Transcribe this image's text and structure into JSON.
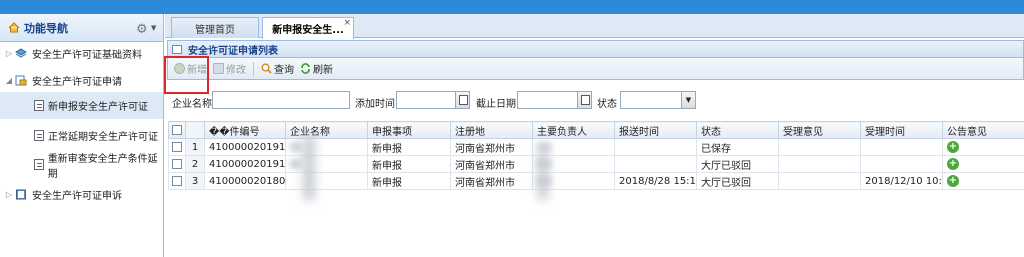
{
  "sidebar": {
    "title": "功能导航",
    "nodes": [
      {
        "label": "安全生产许可证基础资料",
        "expanded": false
      },
      {
        "label": "安全生产许可证申请",
        "expanded": true
      },
      {
        "label": "安全生产许可证申诉",
        "expanded": false
      }
    ],
    "sub_items": [
      {
        "label": "新申报安全生产许可证",
        "selected": true
      },
      {
        "label": "正常延期安全生产许可证",
        "selected": false
      },
      {
        "label": "重新审查安全生产条件延期",
        "selected": false
      }
    ]
  },
  "tabs": [
    {
      "label": "管理首页",
      "active": false
    },
    {
      "label": "新申报安全生...",
      "active": true,
      "close": "×"
    }
  ],
  "panel": {
    "title": "安全许可证申请列表"
  },
  "toolbar": {
    "add": "新增",
    "edit": "修改",
    "query": "查询",
    "refresh": "刷新"
  },
  "search": {
    "company_label": "企业名称",
    "company_value": "",
    "add_time_label": "添加时间",
    "add_time_value": "",
    "deadline_label": "截止日期",
    "deadline_value": "",
    "status_label": "状态",
    "status_value": ""
  },
  "grid": {
    "headers": [
      "��件编号",
      "企业名称",
      "申报事项",
      "注册地",
      "主要负责人",
      "报送时间",
      "状态",
      "受理意见",
      "受理时间",
      "公告意见"
    ],
    "rows": [
      {
        "num": "1",
        "code": "410000020191...",
        "company": "",
        "item": "新申报",
        "reg": "河南省郑州市",
        "leader": "",
        "submit": "",
        "status": "已保存",
        "opinion": "",
        "accept_time": ""
      },
      {
        "num": "2",
        "code": "410000020191...",
        "company": "",
        "item": "新申报",
        "reg": "河南省郑州市",
        "leader": "",
        "submit": "",
        "status": "大厅已驳回",
        "opinion": "",
        "accept_time": ""
      },
      {
        "num": "3",
        "code": "410000020180...",
        "company": "",
        "item": "新申报",
        "reg": "河南省郑州市",
        "leader": "",
        "submit": "2018/8/28 15:1...",
        "status": "大厅已驳回",
        "opinion": "",
        "accept_time": "2018/12/10 10:..."
      }
    ]
  },
  "colors": {
    "topbar": "#2d8ad9",
    "header_text": "#15428b",
    "highlight": "#e0262b",
    "add_icon": "#4aa83a"
  }
}
